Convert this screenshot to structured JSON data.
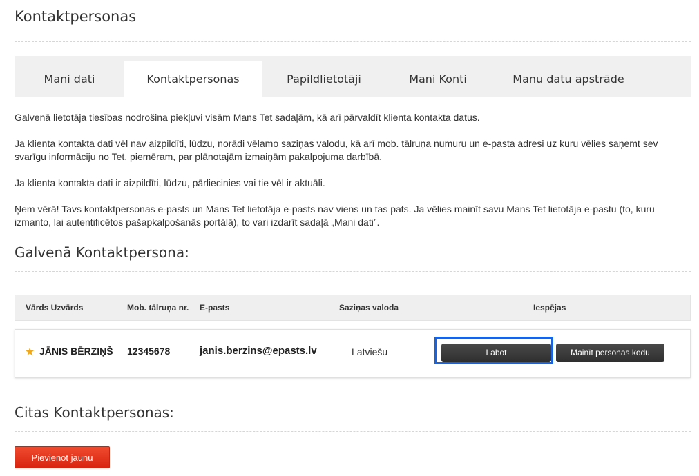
{
  "page": {
    "title": "Kontaktpersonas"
  },
  "tabs": [
    {
      "label": "Mani dati"
    },
    {
      "label": "Kontaktpersonas"
    },
    {
      "label": "Papildlietotāji"
    },
    {
      "label": "Mani Konti"
    },
    {
      "label": "Manu datu apstrāde"
    }
  ],
  "intro": {
    "p1": "Galvenā lietotāja tiesības nodrošina piekļuvi visām Mans Tet sadaļām, kā arī pārvaldīt klienta kontakta datus.",
    "p2": "Ja klienta kontakta dati vēl nav aizpildīti, lūdzu, norādi vēlamo saziņas valodu, kā arī mob. tālruņa numuru un e-pasta adresi uz kuru vēlies saņemt sev svarīgu informāciju no Tet, piemēram, par plānotajām izmaiņām pakalpojuma darbībā.",
    "p3": "Ja klienta kontakta dati ir aizpildīti, lūdzu, pārliecinies vai tie vēl ir aktuāli.",
    "p4": "Ņem vērā! Tavs kontaktpersonas e-pasts un Mans Tet lietotāja e-pasts nav viens un tas pats. Ja vēlies mainīt savu Mans Tet lietotāja e-pastu (to, kuru izmanto, lai autentificētos pašapkalpošanās portālā), to vari izdarīt sadaļā „Mani dati”."
  },
  "main_contact": {
    "title": "Galvenā Kontaktpersona:",
    "columns": {
      "name": "Vārds Uzvārds",
      "phone": "Mob. tālruņa nr.",
      "email": "E-pasts",
      "language": "Saziņas valoda",
      "options": "Iespējas"
    },
    "row": {
      "star_icon": "star-icon",
      "star_color": "#f0a818",
      "name": "JĀNIS BĒRZIŅŠ",
      "phone": "12345678",
      "email": "janis.berzins@epasts.lv",
      "language": "Latviešu",
      "edit_label": "Labot",
      "change_code_label": "Mainīt personas kodu"
    }
  },
  "other_contacts": {
    "title": "Citas Kontaktpersonas:",
    "add_label": "Pievienot jaunu"
  },
  "colors": {
    "accent_red": "#e8311f",
    "focus_blue": "#1a63e0",
    "dark_button": "#3b3b3b"
  }
}
